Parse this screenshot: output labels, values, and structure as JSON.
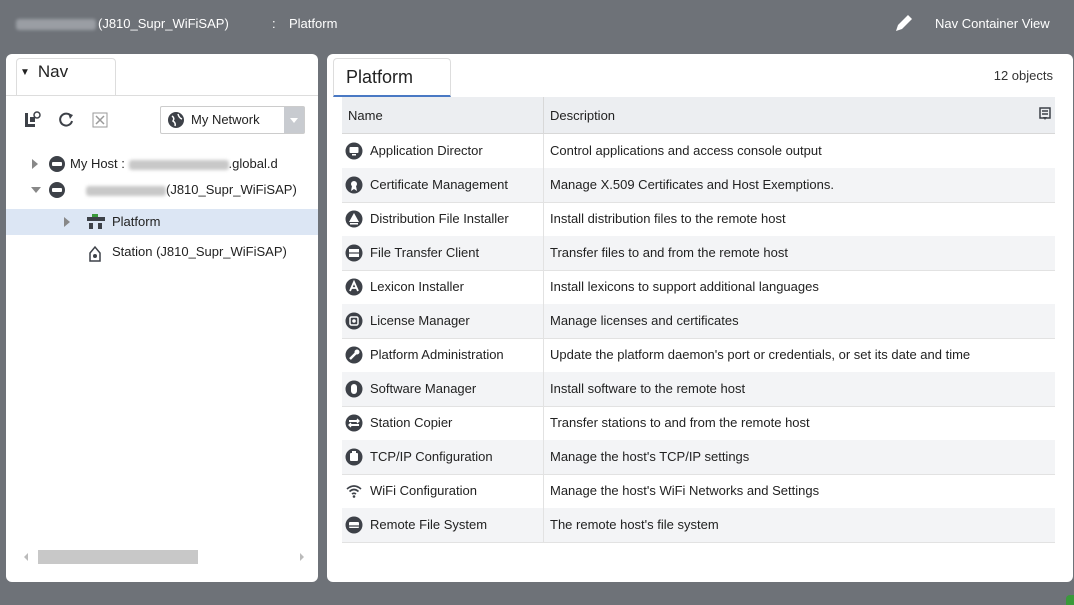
{
  "header": {
    "host_suffix": "(J810_Supr_WiFiSAP)",
    "separator": ":",
    "current": "Platform",
    "view_selector": "Nav Container View"
  },
  "nav": {
    "tab_label": "Nav",
    "network_select": "My Network",
    "tree": [
      {
        "label_prefix": "My Host :",
        "label_suffix": ".global.d",
        "expanded": false
      },
      {
        "label_suffix": "(J810_Supr_WiFiSAP)",
        "expanded": true
      },
      {
        "label": "Platform",
        "selected": true
      },
      {
        "label": "Station (J810_Supr_WiFiSAP)"
      }
    ]
  },
  "main": {
    "tab_label": "Platform",
    "object_count": "12 objects",
    "columns": [
      "Name",
      "Description"
    ],
    "rows": [
      {
        "name": "Application Director",
        "desc": "Control applications and access console output",
        "icon": "app-director-icon"
      },
      {
        "name": "Certificate Management",
        "desc": "Manage X.509 Certificates and Host Exemptions.",
        "icon": "certificate-icon"
      },
      {
        "name": "Distribution File Installer",
        "desc": "Install distribution files to the remote host",
        "icon": "distribution-icon"
      },
      {
        "name": "File Transfer Client",
        "desc": "Transfer files to and from the remote host",
        "icon": "file-transfer-icon"
      },
      {
        "name": "Lexicon Installer",
        "desc": "Install lexicons to support additional languages",
        "icon": "lexicon-icon"
      },
      {
        "name": "License Manager",
        "desc": "Manage licenses and certificates",
        "icon": "license-icon"
      },
      {
        "name": "Platform Administration",
        "desc": "Update the platform daemon's port or credentials, or set its date and time",
        "icon": "platform-admin-icon"
      },
      {
        "name": "Software Manager",
        "desc": "Install software to the remote host",
        "icon": "software-icon"
      },
      {
        "name": "Station Copier",
        "desc": "Transfer stations to and from the remote host",
        "icon": "station-copier-icon"
      },
      {
        "name": "TCP/IP Configuration",
        "desc": "Manage the host's TCP/IP settings",
        "icon": "tcpip-icon"
      },
      {
        "name": "WiFi Configuration",
        "desc": "Manage the host's WiFi Networks and Settings",
        "icon": "wifi-icon"
      },
      {
        "name": "Remote File System",
        "desc": "The remote host's file system",
        "icon": "remote-fs-icon"
      }
    ]
  },
  "colors": {
    "chrome": "#6e7278",
    "selection": "#dce6f4",
    "accent": "#4a79c4",
    "icon": "#3d4148"
  }
}
